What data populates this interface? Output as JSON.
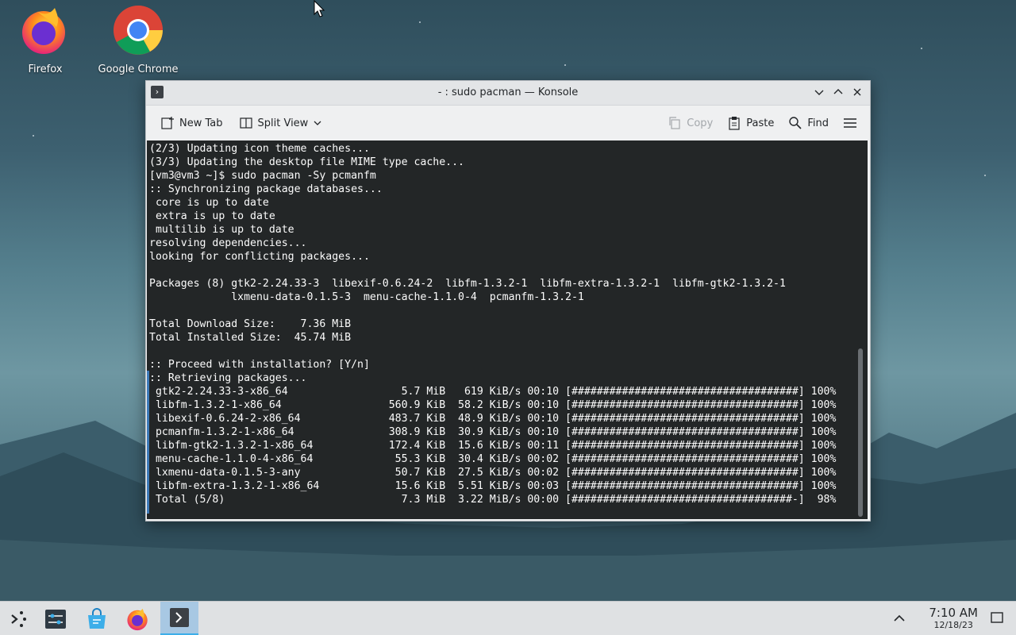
{
  "desktop": {
    "icons": [
      {
        "label": "Firefox",
        "icon": "firefox-icon"
      },
      {
        "label": "Google Chrome",
        "icon": "chrome-icon"
      }
    ]
  },
  "window": {
    "title": "- : sudo pacman — Konsole",
    "toolbar": {
      "new_tab": "New Tab",
      "split_view": "Split View",
      "copy": "Copy",
      "paste": "Paste",
      "find": "Find"
    },
    "terminal_lines": [
      "(2/3) Updating icon theme caches...",
      "(3/3) Updating the desktop file MIME type cache...",
      "[vm3@vm3 ~]$ sudo pacman -Sy pcmanfm",
      ":: Synchronizing package databases...",
      " core is up to date",
      " extra is up to date",
      " multilib is up to date",
      "resolving dependencies...",
      "looking for conflicting packages...",
      "",
      "Packages (8) gtk2-2.24.33-3  libexif-0.6.24-2  libfm-1.3.2-1  libfm-extra-1.3.2-1  libfm-gtk2-1.3.2-1",
      "             lxmenu-data-0.1.5-3  menu-cache-1.1.0-4  pcmanfm-1.3.2-1",
      "",
      "Total Download Size:    7.36 MiB",
      "Total Installed Size:  45.74 MiB",
      "",
      ":: Proceed with installation? [Y/n]",
      ":: Retrieving packages...",
      " gtk2-2.24.33-3-x86_64                  5.7 MiB   619 KiB/s 00:10 [####################################] 100%",
      " libfm-1.3.2-1-x86_64                 560.9 KiB  58.2 KiB/s 00:10 [####################################] 100%",
      " libexif-0.6.24-2-x86_64              483.7 KiB  48.9 KiB/s 00:10 [####################################] 100%",
      " pcmanfm-1.3.2-1-x86_64               308.9 KiB  30.9 KiB/s 00:10 [####################################] 100%",
      " libfm-gtk2-1.3.2-1-x86_64            172.4 KiB  15.6 KiB/s 00:11 [####################################] 100%",
      " menu-cache-1.1.0-4-x86_64             55.3 KiB  30.4 KiB/s 00:02 [####################################] 100%",
      " lxmenu-data-0.1.5-3-any               50.7 KiB  27.5 KiB/s 00:02 [####################################] 100%",
      " libfm-extra-1.3.2-1-x86_64            15.6 KiB  5.51 KiB/s 00:03 [####################################] 100%",
      " Total (5/8)                            7.3 MiB  3.22 MiB/s 00:00 [###################################-]  98%"
    ]
  },
  "taskbar": {
    "items": [
      "application-launcher-icon",
      "system-settings-icon",
      "discover-icon",
      "firefox-icon",
      "konsole-icon"
    ],
    "clock_time": "7:10 AM",
    "clock_date": "12/18/23"
  }
}
